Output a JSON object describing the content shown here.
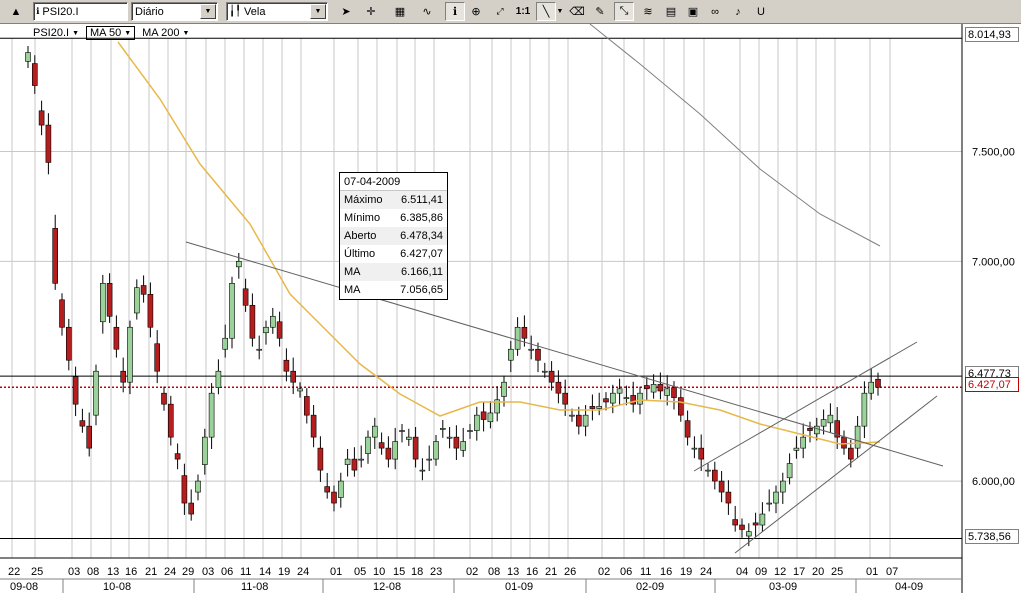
{
  "toolbar": {
    "symbol": "PSI20.I",
    "interval": "Diário",
    "chart_style": "Vela",
    "zoom_label": "1:1"
  },
  "legend": {
    "symbol": "PSI20.I",
    "ma50": "MA 50",
    "ma200": "MA 200"
  },
  "tooltip": {
    "date": "07-04-2009",
    "rows": [
      {
        "label": "Máximo",
        "value": "6.511,41"
      },
      {
        "label": "Mínimo",
        "value": "6.385,86"
      },
      {
        "label": "Aberto",
        "value": "6.478,34"
      },
      {
        "label": "Último",
        "value": "6.427,07"
      },
      {
        "label": "MA",
        "value": "6.166,11"
      },
      {
        "label": "MA",
        "value": "7.056,65"
      }
    ]
  },
  "price_labels": {
    "top": "8.014,93",
    "last": "6.477,73",
    "close": "6.427,07",
    "bottom": "5.738,56"
  },
  "colors": {
    "up": "#9ad29a",
    "down": "#b41e1e",
    "ma50": "#e8b84a",
    "ma200": "#808080",
    "grid": "#c8c8c8"
  },
  "chart_data": {
    "type": "candlestick",
    "y_ticks": [
      "7.500,00",
      "7.000,00",
      "6.000,00"
    ],
    "ylim": [
      5650,
      8080
    ],
    "x_day_labels": [
      "22",
      "25",
      "03",
      "08",
      "13",
      "16",
      "21",
      "24",
      "29",
      "03",
      "06",
      "11",
      "14",
      "19",
      "24",
      "01",
      "05",
      "10",
      "15",
      "18",
      "23",
      "02",
      "08",
      "13",
      "16",
      "21",
      "26",
      "02",
      "06",
      "11",
      "16",
      "19",
      "24",
      "04",
      "09",
      "12",
      "17",
      "20",
      "25",
      "01",
      "07"
    ],
    "x_month_labels": [
      "09-08",
      "10-08",
      "11-08",
      "12-08",
      "01-09",
      "02-09",
      "03-09",
      "04-09"
    ],
    "last_close": 6427.07,
    "last_high": 6477.73
  }
}
